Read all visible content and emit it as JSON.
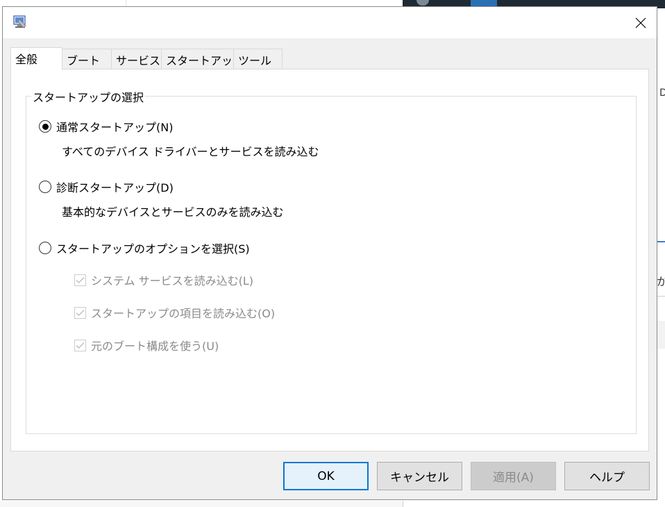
{
  "background": {
    "right_text_1": "D",
    "right_text_2": "か"
  },
  "dialog": {
    "tabs": [
      {
        "label": "全般",
        "active": true
      },
      {
        "label": "ブート",
        "active": false
      },
      {
        "label": "サービス",
        "active": false
      },
      {
        "label": "スタートアップ",
        "active": false
      },
      {
        "label": "ツール",
        "active": false
      }
    ],
    "group_title": "スタートアップの選択",
    "options": [
      {
        "label": "通常スタートアップ(N)",
        "description": "すべてのデバイス ドライバーとサービスを読み込む",
        "selected": true
      },
      {
        "label": "診断スタートアップ(D)",
        "description": "基本的なデバイスとサービスのみを読み込む",
        "selected": false
      },
      {
        "label": "スタートアップのオプションを選択(S)",
        "selected": false
      }
    ],
    "checkboxes": [
      {
        "label": "システム サービスを読み込む(L)",
        "checked": true,
        "enabled": false
      },
      {
        "label": "スタートアップの項目を読み込む(O)",
        "checked": true,
        "enabled": false
      },
      {
        "label": "元のブート構成を使う(U)",
        "checked": true,
        "enabled": false
      }
    ],
    "buttons": {
      "ok": "OK",
      "cancel": "キャンセル",
      "apply": "適用(A)",
      "help": "ヘルプ"
    },
    "accent_color": "#0078d7"
  }
}
